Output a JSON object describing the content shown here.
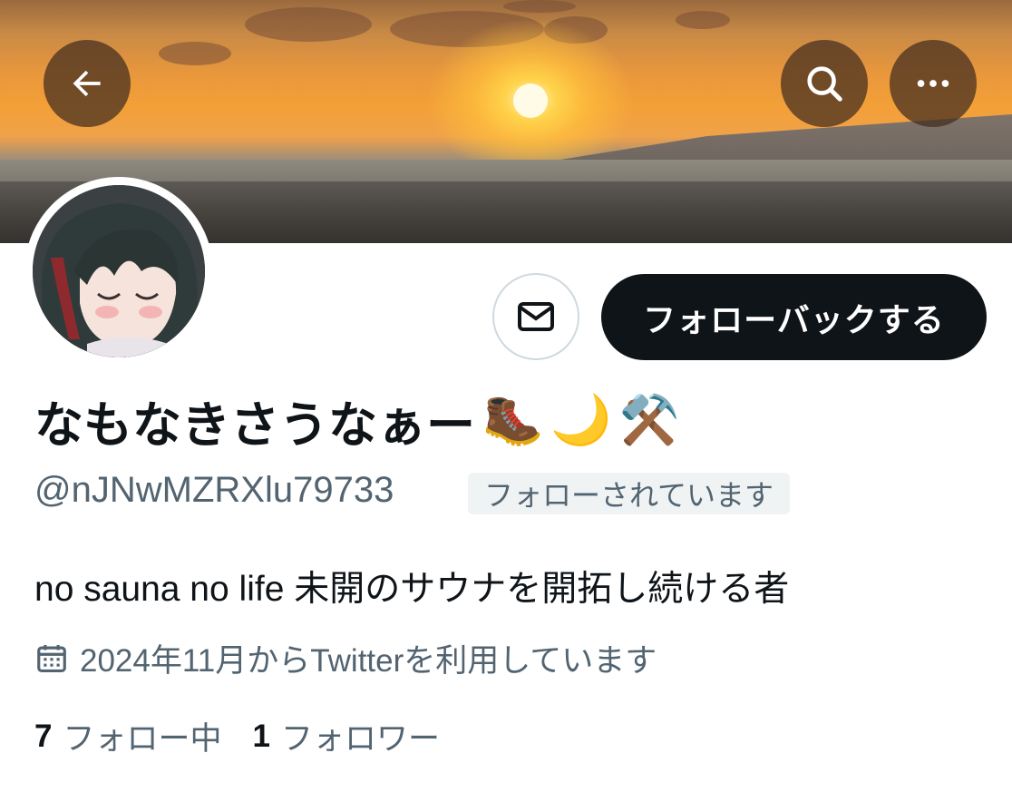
{
  "banner": {
    "description_icon": "sunset-photo"
  },
  "header": {
    "back_icon": "arrow-left-icon",
    "search_icon": "search-icon",
    "more_icon": "more-horizontal-icon"
  },
  "profile": {
    "avatar_icon": "avatar",
    "display_name": "なもなきさうなぁー",
    "name_emojis": [
      "🥾",
      "🌙",
      "⚒️"
    ],
    "handle": "@nJNwMZRXlu79733",
    "follows_you_badge": "フォローされています",
    "bio": "no sauna no life 未開のサウナを開拓し続ける者",
    "joined": "2024年11月からTwitterを利用しています",
    "following_count": "7",
    "following_label": "フォロー中",
    "followers_count": "1",
    "followers_label": "フォロワー"
  },
  "actions": {
    "message_icon": "mail-icon",
    "follow_back_label": "フォローバックする"
  },
  "colors": {
    "primary_text": "#0f1419",
    "secondary_text": "#536471",
    "button_dark": "#0f1419",
    "badge_bg": "#eff3f4"
  }
}
